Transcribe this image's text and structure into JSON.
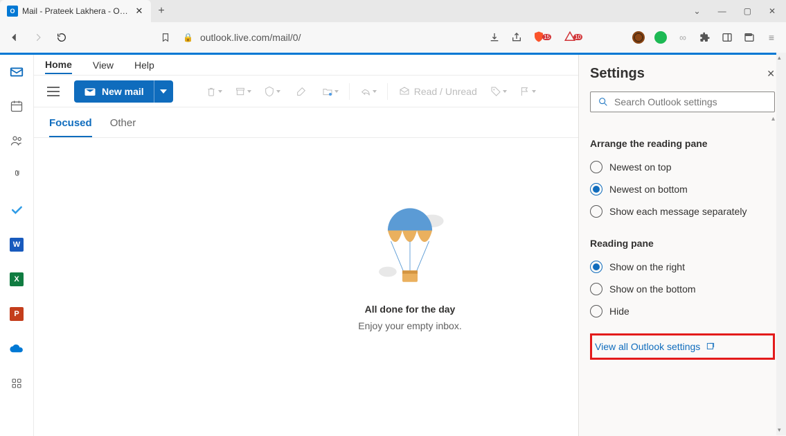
{
  "browser": {
    "tab_title": "Mail - Prateek Lakhera - Outlook",
    "url": "outlook.live.com/mail/0/",
    "badge1": "15",
    "badge2": "10"
  },
  "menu": {
    "home": "Home",
    "view": "View",
    "help": "Help"
  },
  "toolbar": {
    "new_mail": "New mail",
    "read_unread": "Read / Unread"
  },
  "inbox": {
    "focused": "Focused",
    "other": "Other",
    "empty_title": "All done for the day",
    "empty_sub": "Enjoy your empty inbox."
  },
  "settings": {
    "title": "Settings",
    "search_placeholder": "Search Outlook settings",
    "group1_title": "Arrange the reading pane",
    "group1": {
      "opt1": "Newest on top",
      "opt2": "Newest on bottom",
      "opt3": "Show each message separately"
    },
    "group2_title": "Reading pane",
    "group2": {
      "opt1": "Show on the right",
      "opt2": "Show on the bottom",
      "opt3": "Hide"
    },
    "view_all": "View all Outlook settings"
  }
}
